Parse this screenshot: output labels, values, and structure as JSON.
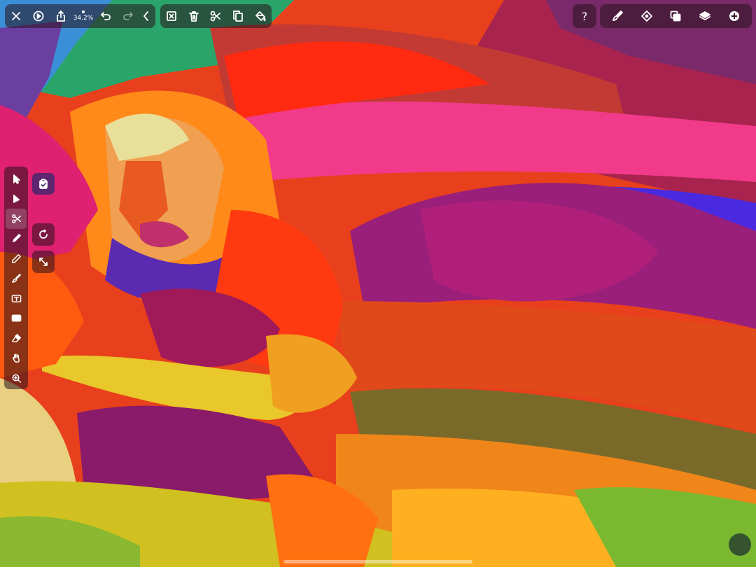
{
  "app": {
    "zoom_label": "34.2%"
  },
  "icons": {
    "top_left": [
      "close-icon",
      "play-icon",
      "share-icon",
      "undo-icon",
      "redo-icon",
      "chevron-left-icon"
    ],
    "edit_bar": [
      "deselect-icon",
      "trash-icon",
      "scissors-icon",
      "copy-icon",
      "paint-bucket-icon"
    ],
    "top_right": [
      "help-icon",
      "brush-settings-icon",
      "transform-icon",
      "boolean-icon",
      "layers-icon",
      "add-icon"
    ],
    "tools": [
      "select-icon",
      "direct-select-icon",
      "scissors-icon",
      "pen-icon",
      "pencil-icon",
      "brush-icon",
      "text-icon",
      "shape-icon",
      "eraser-icon",
      "hand-icon",
      "zoom-icon"
    ],
    "floating": [
      "clipboard-check-icon",
      "rotate-icon",
      "expand-icon"
    ]
  },
  "help": {
    "label": "?"
  },
  "active_tool": "scissors",
  "colors": {
    "toolbar_bg": "#28121c",
    "accent": "#ffffff"
  }
}
